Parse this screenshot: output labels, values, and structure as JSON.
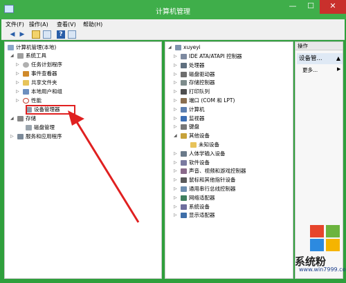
{
  "window": {
    "title": "计算机管理"
  },
  "menu": [
    "文件(F)",
    "操作(A)",
    "查看(V)",
    "帮助(H)"
  ],
  "left_tree": {
    "root": "计算机管理(本地)",
    "items": [
      {
        "label": "系统工具",
        "expanded": true
      },
      {
        "label": "任务计划程序"
      },
      {
        "label": "事件查看器"
      },
      {
        "label": "共享文件夹"
      },
      {
        "label": "本地用户和组"
      },
      {
        "label": "性能"
      },
      {
        "label": "设备管理器",
        "selected": true
      },
      {
        "label": "存储",
        "expanded": true
      },
      {
        "label": "磁盘管理"
      },
      {
        "label": "服务和应用程序"
      }
    ]
  },
  "device_tree": {
    "root": "xuyeyi",
    "items": [
      "IDE ATA/ATAPI 控制器",
      "处理器",
      "磁盘驱动器",
      "存储控制器",
      "打印队列",
      "端口 (COM 和 LPT)",
      "计算机",
      "监视器",
      "键盘",
      "其他设备",
      "未知设备",
      "人体学输入设备",
      "软件设备",
      "声音、视频和游戏控制器",
      "鼠标和其他指针设备",
      "通用串行总线控制器",
      "网络适配器",
      "系统设备",
      "显示适配器"
    ]
  },
  "actions": {
    "title": "操作",
    "heading": "设备管...",
    "more": "更多..."
  },
  "watermark": {
    "name": "系统粉",
    "url": "www.win7999.com"
  }
}
